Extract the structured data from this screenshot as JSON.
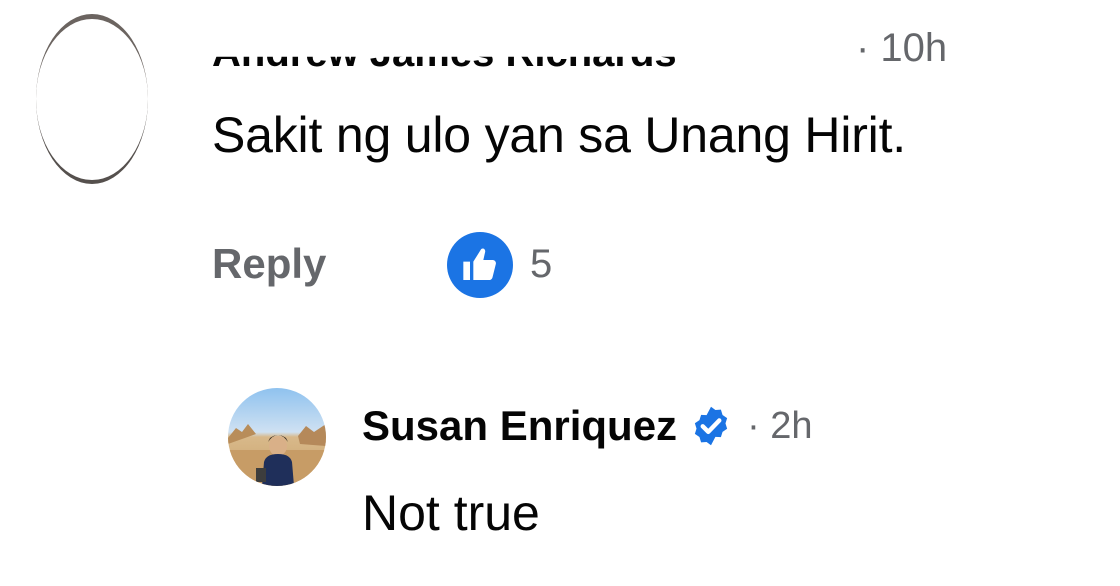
{
  "comment": {
    "author_partial": "Andrew James Richards",
    "time": "· 10h",
    "text": "Sakit ng ulo yan sa Unang Hirit.",
    "actions": {
      "reply_label": "Reply",
      "like_count": "5"
    }
  },
  "reply": {
    "author": "Susan Enriquez",
    "verified_icon": "verified-badge-icon",
    "time": "· 2h",
    "text": "Not true"
  },
  "colors": {
    "text_primary": "#050505",
    "text_secondary": "#65676b",
    "like_blue": "#1b74e4"
  }
}
